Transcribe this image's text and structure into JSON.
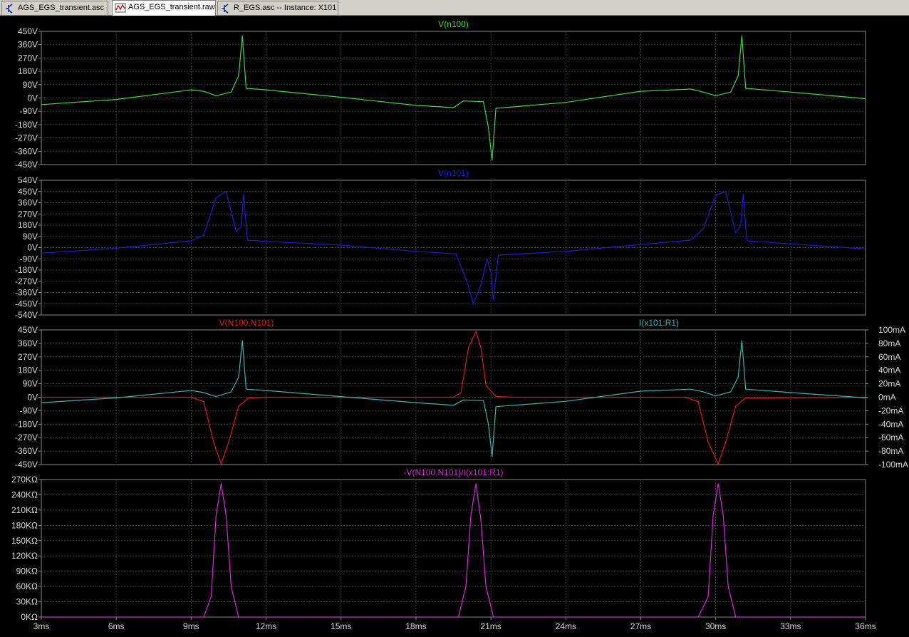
{
  "tabs": [
    {
      "label": "AGS_EGS_transient.asc",
      "icon": "schematic-icon",
      "active": false
    },
    {
      "label": "AGS_EGS_transient.raw",
      "icon": "waveform-icon",
      "active": true
    },
    {
      "label": "R_EGS.asc -- Instance: X101",
      "icon": "schematic-icon",
      "active": false
    }
  ],
  "colors": {
    "background": "#000000",
    "grid": "#3c3c3c",
    "axis_text": "#d8d8d8",
    "green": "#3cd83c",
    "blue": "#1c1cd0",
    "red": "#e01818",
    "cyan": "#38b4b4",
    "magenta": "#e020e0"
  },
  "x_ticks": [
    "3ms",
    "6ms",
    "9ms",
    "12ms",
    "15ms",
    "18ms",
    "21ms",
    "24ms",
    "27ms",
    "30ms",
    "33ms",
    "36ms"
  ],
  "panes": [
    {
      "title": "V(n100)",
      "title_color": "#3cd83c",
      "y_ticks": [
        "450V",
        "360V",
        "270V",
        "180V",
        "90V",
        "0V",
        "-90V",
        "-180V",
        "-270V",
        "-360V",
        "-450V"
      ]
    },
    {
      "title": "V(n101)",
      "title_color": "#1c1cd0",
      "y_ticks": [
        "540V",
        "450V",
        "360V",
        "270V",
        "180V",
        "90V",
        "0V",
        "-90V",
        "-180V",
        "-270V",
        "-360V",
        "-450V",
        "-540V"
      ]
    },
    {
      "title": "V(N100,N101)",
      "title_color": "#e01818",
      "title_right": "I(x101:R1)",
      "title_right_color": "#38b4b4",
      "y_ticks": [
        "450V",
        "360V",
        "270V",
        "180V",
        "90V",
        "0V",
        "-90V",
        "-180V",
        "-270V",
        "-360V",
        "-450V"
      ],
      "y2_ticks": [
        "100mA",
        "80mA",
        "60mA",
        "40mA",
        "20mA",
        "0mA",
        "-20mA",
        "-40mA",
        "-60mA",
        "-80mA",
        "-100mA"
      ]
    },
    {
      "title": "-V(N100,N101)/I(x101:R1)",
      "title_color": "#e020e0",
      "y_ticks": [
        "270KΩ",
        "240KΩ",
        "210KΩ",
        "180KΩ",
        "150KΩ",
        "120KΩ",
        "90KΩ",
        "60KΩ",
        "30KΩ",
        "0KΩ"
      ]
    }
  ],
  "chart_data": [
    {
      "type": "line",
      "title": "V(n100)",
      "x_unit": "ms",
      "ylim": [
        -450,
        450
      ],
      "y_unit": "V",
      "grid": true,
      "series": [
        {
          "name": "V(n100)",
          "color": "#3cd83c",
          "x": [
            3,
            6,
            9,
            9.5,
            10,
            10.6,
            10.9,
            11.05,
            11.2,
            12,
            15,
            18,
            19.5,
            19.9,
            20.7,
            20.9,
            21.05,
            21.2,
            24,
            27,
            29,
            29.5,
            30,
            30.6,
            30.9,
            31.05,
            31.2,
            33,
            36
          ],
          "y": [
            -45,
            -10,
            55,
            45,
            15,
            40,
            150,
            420,
            65,
            55,
            5,
            -50,
            -65,
            -20,
            -25,
            -200,
            -420,
            -70,
            -30,
            45,
            60,
            40,
            15,
            40,
            150,
            420,
            65,
            40,
            -5
          ]
        }
      ]
    },
    {
      "type": "line",
      "title": "V(n101)",
      "x_unit": "ms",
      "ylim": [
        -540,
        540
      ],
      "y_unit": "V",
      "grid": true,
      "series": [
        {
          "name": "V(n101)",
          "color": "#1c1cd0",
          "x": [
            3,
            6,
            9,
            9.5,
            10,
            10.4,
            10.8,
            11.0,
            11.1,
            11.25,
            12,
            15,
            18,
            19.6,
            20.0,
            20.3,
            20.6,
            20.85,
            21.0,
            21.1,
            21.3,
            24,
            27,
            29,
            29.5,
            30,
            30.4,
            30.8,
            31.0,
            31.1,
            31.25,
            33,
            36
          ],
          "y": [
            -45,
            -5,
            55,
            100,
            400,
            450,
            130,
            170,
            430,
            60,
            50,
            20,
            -30,
            -50,
            -250,
            -450,
            -300,
            -90,
            -200,
            -420,
            -60,
            -30,
            25,
            60,
            150,
            420,
            450,
            120,
            180,
            430,
            55,
            30,
            -10
          ]
        }
      ]
    },
    {
      "type": "line",
      "title": "V(N100,N101) / I(x101:R1)",
      "x_unit": "ms",
      "ylim": [
        -450,
        450
      ],
      "y_unit": "V",
      "y2lim": [
        -100,
        100
      ],
      "y2_unit": "mA",
      "grid": true,
      "series": [
        {
          "name": "V(N100,N101)",
          "color": "#e01818",
          "x": [
            3,
            9,
            9.5,
            9.9,
            10.2,
            10.5,
            10.9,
            11.3,
            12,
            19.5,
            19.8,
            20.1,
            20.4,
            20.6,
            20.8,
            21.2,
            22,
            28.8,
            29.3,
            29.7,
            30.1,
            30.4,
            30.8,
            31.2,
            36
          ],
          "y": [
            0,
            0,
            -30,
            -300,
            -445,
            -300,
            -60,
            -5,
            0,
            0,
            30,
            330,
            440,
            330,
            80,
            5,
            0,
            0,
            -30,
            -300,
            -445,
            -300,
            -60,
            -5,
            0
          ]
        },
        {
          "name": "I(x101:R1)",
          "color": "#38b4b4",
          "axis": "right",
          "y_unit": "mA",
          "x": [
            3,
            6,
            9,
            9.5,
            10,
            10.6,
            10.9,
            11.05,
            11.2,
            12,
            15,
            18,
            19.5,
            19.9,
            20.7,
            20.9,
            21.05,
            21.2,
            24,
            27,
            29,
            29.5,
            30,
            30.6,
            30.9,
            31.05,
            31.2,
            33,
            36
          ],
          "y": [
            -8,
            -1,
            10,
            7,
            1,
            8,
            30,
            84,
            12,
            10,
            1,
            -8,
            -12,
            -4,
            -5,
            -40,
            -88,
            -14,
            -6,
            9,
            12,
            8,
            2,
            8,
            30,
            84,
            12,
            7,
            -1
          ]
        }
      ]
    },
    {
      "type": "line",
      "title": "-V(N100,N101)/I(x101:R1)",
      "x_unit": "ms",
      "ylim": [
        0,
        270
      ],
      "y_unit": "KΩ",
      "grid": true,
      "series": [
        {
          "name": "-V(N100,N101)/I(x101:R1)",
          "color": "#e020e0",
          "x": [
            3,
            9,
            9.5,
            9.8,
            10.0,
            10.2,
            10.4,
            10.6,
            10.9,
            11.3,
            19.3,
            19.7,
            20.0,
            20.2,
            20.4,
            20.6,
            20.8,
            21.1,
            21.5,
            28.8,
            29.3,
            29.7,
            29.9,
            30.1,
            30.3,
            30.5,
            30.8,
            31.3,
            36
          ],
          "y": [
            0,
            0,
            0,
            40,
            200,
            262,
            200,
            60,
            0,
            0,
            0,
            0,
            60,
            200,
            262,
            190,
            60,
            0,
            0,
            0,
            0,
            40,
            200,
            262,
            200,
            60,
            0,
            0,
            0
          ]
        }
      ]
    }
  ]
}
